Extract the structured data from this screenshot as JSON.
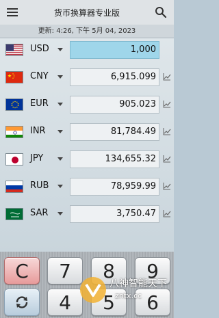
{
  "header": {
    "title": "货币换算器专业版",
    "menu_icon": "menu-icon",
    "search_icon": "search-icon"
  },
  "updated_text": "更新: 4:26, 下午 5月 04, 2023",
  "base": {
    "code": "USD",
    "amount": "1,000",
    "flag": "us-flag"
  },
  "rates": [
    {
      "code": "CNY",
      "amount": "6,915.099",
      "flag": "cn-flag"
    },
    {
      "code": "EUR",
      "amount": "905.023",
      "flag": "eu-flag"
    },
    {
      "code": "INR",
      "amount": "81,784.49",
      "flag": "in-flag"
    },
    {
      "code": "JPY",
      "amount": "134,655.32",
      "flag": "jp-flag"
    },
    {
      "code": "RUB",
      "amount": "78,959.99",
      "flag": "ru-flag"
    },
    {
      "code": "SAR",
      "amount": "3,750.47",
      "flag": "sa-flag"
    }
  ],
  "keys": {
    "clear": "C",
    "seven": "7",
    "eight": "8",
    "nine": "9",
    "four": "4",
    "five": "5",
    "six": "6",
    "refresh_icon": "refresh-icon"
  },
  "watermark": {
    "text": "八神智能天下",
    "sub": "zntx.cc"
  },
  "colors": {
    "active_field": "#9fd6ea",
    "clear_key": "#e79b9b",
    "background": "#b9c9d4"
  }
}
